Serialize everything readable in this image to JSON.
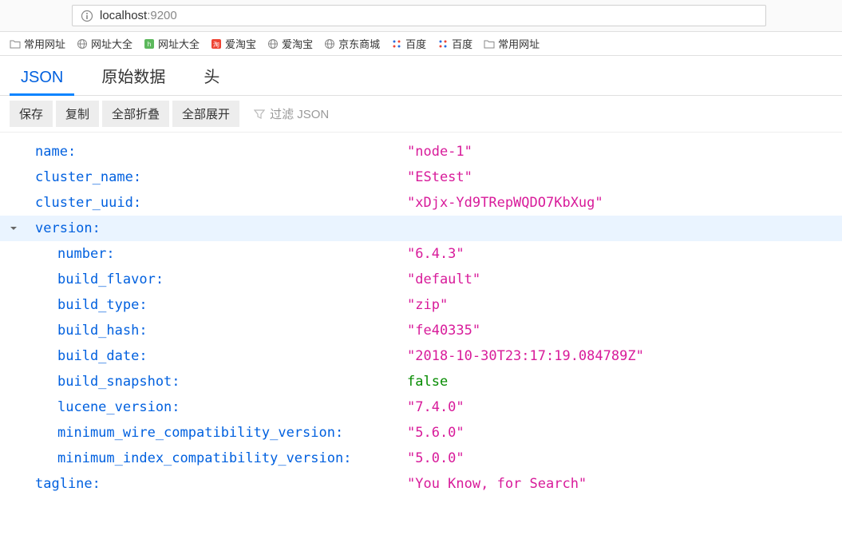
{
  "url": {
    "host": "localhost",
    "port": ":9200"
  },
  "bookmarks": [
    {
      "label": "常用网址",
      "icon": "folder"
    },
    {
      "label": "网址大全",
      "icon": "globe"
    },
    {
      "label": "网址大全",
      "icon": "hao"
    },
    {
      "label": "爱淘宝",
      "icon": "tao"
    },
    {
      "label": "爱淘宝",
      "icon": "globe"
    },
    {
      "label": "京东商城",
      "icon": "globe"
    },
    {
      "label": "百度",
      "icon": "baidu"
    },
    {
      "label": "百度",
      "icon": "baidu"
    },
    {
      "label": "常用网址",
      "icon": "folder"
    }
  ],
  "tabs": [
    {
      "label": "JSON",
      "active": true
    },
    {
      "label": "原始数据",
      "active": false
    },
    {
      "label": "头",
      "active": false
    }
  ],
  "toolbar": {
    "save": "保存",
    "copy": "复制",
    "collapseAll": "全部折叠",
    "expandAll": "全部展开",
    "filterPlaceholder": "过滤 JSON"
  },
  "json": {
    "name": "\"node-1\"",
    "cluster_name": "\"EStest\"",
    "cluster_uuid": "\"xDjx-Yd9TRepWQDO7KbXug\"",
    "version_key": "version",
    "version": {
      "number": "\"6.4.3\"",
      "build_flavor": "\"default\"",
      "build_type": "\"zip\"",
      "build_hash": "\"fe40335\"",
      "build_date": "\"2018-10-30T23:17:19.084789Z\"",
      "build_snapshot": "false",
      "lucene_version": "\"7.4.0\"",
      "minimum_wire_compatibility_version": "\"5.6.0\"",
      "minimum_index_compatibility_version": "\"5.0.0\""
    },
    "tagline": "\"You Know, for Search\""
  },
  "keys": {
    "name": "name",
    "cluster_name": "cluster_name",
    "cluster_uuid": "cluster_uuid",
    "number": "number",
    "build_flavor": "build_flavor",
    "build_type": "build_type",
    "build_hash": "build_hash",
    "build_date": "build_date",
    "build_snapshot": "build_snapshot",
    "lucene_version": "lucene_version",
    "minimum_wire_compatibility_version": "minimum_wire_compatibility_version",
    "minimum_index_compatibility_version": "minimum_index_compatibility_version",
    "tagline": "tagline"
  }
}
